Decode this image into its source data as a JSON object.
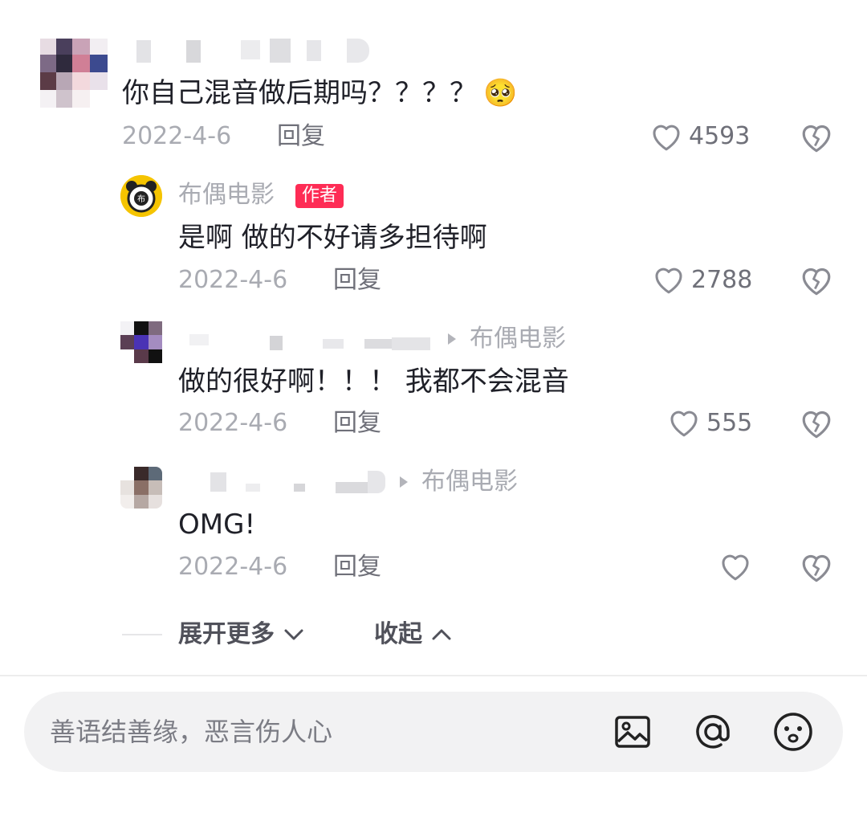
{
  "comments": [
    {
      "text": "你自己混音做后期吗？？？？",
      "emoji": "🥺",
      "date": "2022-4-6",
      "reply_label": "回复",
      "likes": "4593"
    }
  ],
  "replies": [
    {
      "username": "布偶电影",
      "author_badge": "作者",
      "text": "是啊 做的不好请多担待啊",
      "date": "2022-4-6",
      "reply_label": "回复",
      "likes": "2788"
    },
    {
      "reply_to": "布偶电影",
      "text": "做的很好啊！！！ 我都不会混音",
      "date": "2022-4-6",
      "reply_label": "回复",
      "likes": "555"
    },
    {
      "reply_to": "布偶电影",
      "text": "OMG!",
      "date": "2022-4-6",
      "reply_label": "回复",
      "likes": ""
    }
  ],
  "thread_controls": {
    "expand_label": "展开更多",
    "collapse_label": "收起"
  },
  "input_bar": {
    "placeholder": "善语结善缘，恶言伤人心"
  },
  "icons": [
    "heart-icon",
    "broken-heart-icon",
    "image-icon",
    "at-icon",
    "emoji-icon",
    "chevron-down-icon",
    "chevron-up-icon",
    "reply-arrow-icon"
  ],
  "colors": {
    "badge": "#fe2c55",
    "muted_text": "#a9abb2",
    "primary_text": "#161823"
  }
}
